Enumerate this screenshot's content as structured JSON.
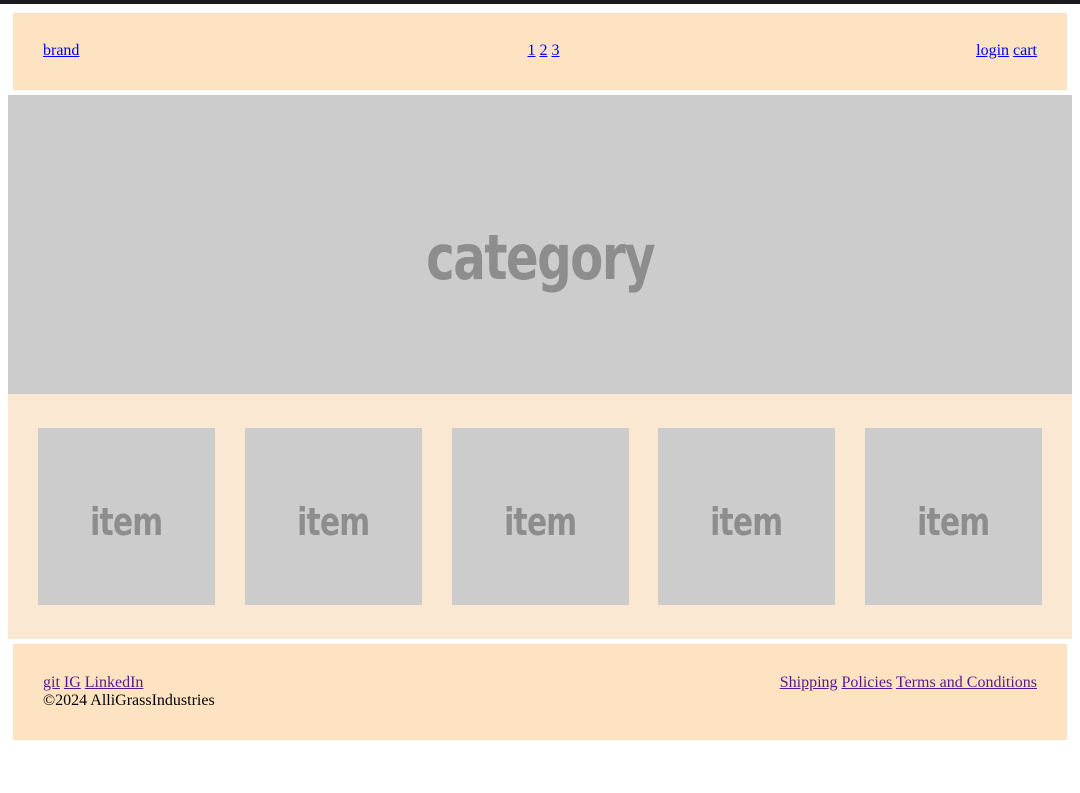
{
  "header": {
    "brand": "brand",
    "pages": [
      "1",
      "2",
      "3"
    ],
    "login": "login",
    "cart": "cart"
  },
  "hero": {
    "label": "category"
  },
  "items": [
    {
      "label": "item"
    },
    {
      "label": "item"
    },
    {
      "label": "item"
    },
    {
      "label": "item"
    },
    {
      "label": "item"
    }
  ],
  "footer": {
    "social": [
      "git",
      "IG",
      "LinkedIn"
    ],
    "copyright": "©2024 AlliGrassIndustries",
    "links": [
      "Shipping",
      "Policies",
      "Terms and Conditions"
    ]
  },
  "colors": {
    "header_bg": "#fde3c2",
    "band_bg": "#fae8d3",
    "placeholder_bg": "#cccccc",
    "placeholder_text": "#8d8d8d",
    "link": "#0000ee",
    "visited_link": "#551a8b"
  }
}
